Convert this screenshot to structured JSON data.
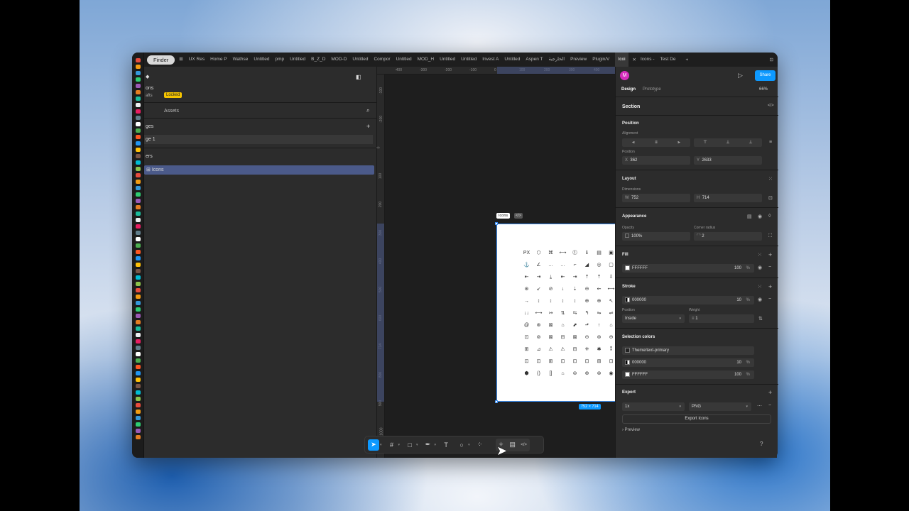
{
  "dock": {
    "app_label": "Finder"
  },
  "tabs": [
    "UX Res",
    "Home P",
    "Wathse",
    "Untitled",
    "pmp",
    "Untitled",
    "B_Z_D",
    "MOD-D",
    "Untitled",
    "Compor",
    "Untitled",
    "MOD_H",
    "Untitled",
    "Untitled",
    "Invest A",
    "Untitled",
    "Aspen T",
    "الخارجية",
    "Preview",
    "Plugin/V"
  ],
  "active_tab": "Icoi",
  "tabs_after": [
    "Icons -",
    "Test De"
  ],
  "left": {
    "file_name": "ons",
    "drafts_label": "afts",
    "locked_badge": "Locked",
    "assets_tab": "Assets",
    "pages_header": "ges",
    "page_item": "ge 1",
    "layers_header": "ers",
    "layer_item": "Icons"
  },
  "rulers": {
    "top": [
      "-400",
      "-300",
      "-200",
      "-100",
      "0",
      "100",
      "200",
      "300",
      "400",
      "500",
      "600",
      "752",
      "900",
      "100"
    ],
    "left": [
      "-100",
      "-200",
      "0",
      "100",
      "200",
      "300",
      "400",
      "500",
      "600",
      "714",
      "800",
      "900",
      "1000"
    ]
  },
  "frame": {
    "label": "Icons",
    "code_icon": "</>",
    "size_badge": "752 × 714"
  },
  "icons": [
    "PX",
    "⬡",
    "⌘",
    "⟷",
    "⓵",
    "ℹ",
    "▤",
    "▣",
    "⊞",
    "⊟",
    "⊡",
    "⊠",
    "⚓",
    "∠",
    "…",
    "…",
    "⌐",
    "◢",
    "◎",
    "▢",
    "⚱",
    "⎙",
    "▭",
    "⊟",
    "⇤",
    "⇥",
    "⤓",
    "⇤",
    "⇥",
    "⤒",
    "⤒",
    "⇩",
    "⇩",
    "◈",
    "⌖",
    "⊗",
    "⊛",
    "↙",
    "⊘",
    "↓",
    "⇣",
    "⊖",
    "⇜",
    "⟷",
    "⟷",
    "⟷",
    "⟷",
    "←",
    "→",
    "↕",
    "↕",
    "↕",
    "↕",
    "⊕",
    "⊕",
    "↖",
    "⊙",
    "↗",
    "↑",
    "↩",
    "↓↓",
    "⟷",
    "↣",
    "⇅",
    "⇆",
    "↰",
    "⇋",
    "⇌",
    "⇄",
    "⤴",
    "⇄",
    "⇉",
    "@",
    "⊛",
    "⊠",
    "⌂",
    "⬈",
    "⬏",
    "↑",
    "⌂",
    "⊗",
    "⌂",
    "⊲",
    "✦",
    "⊡",
    "⊚",
    "⊠",
    "⊟",
    "⊠",
    "⊝",
    "⊚",
    "⊖",
    "⊡",
    "⊙",
    "⊘",
    "⊗",
    "⊞",
    "⊿",
    "⚠",
    "⚠",
    "⊟",
    "⁜",
    "✱",
    "⁑",
    "◑",
    "B",
    "✕",
    "✧",
    "⊡",
    "⊡",
    "⊞",
    "⊡",
    "⊡",
    "⊡",
    "⊞",
    "⊡",
    "⊡",
    "🔒",
    "⊡",
    "⊞",
    "⬢",
    "()",
    "[]",
    "⌂",
    "⊜",
    "⊕",
    "⊛",
    "◉",
    "⊖",
    "⊘",
    "⊛",
    "⊕"
  ],
  "toolbar": {
    "tools": [
      "move",
      "frame",
      "rect",
      "pen",
      "text",
      "comment",
      "components",
      "ai",
      "dev",
      "code"
    ]
  },
  "right": {
    "avatar": "M",
    "share_button": "Share",
    "design_tab": "Design",
    "prototype_tab": "Prototype",
    "zoom": "66%",
    "section_title": "Section",
    "position_title": "Position",
    "alignment_label": "Alignment",
    "position_label": "Position",
    "x_label": "X",
    "x_value": "362",
    "y_label": "Y",
    "y_value": "2633",
    "layout_title": "Layout",
    "dimensions_label": "Dimensions",
    "w_label": "W",
    "w_value": "752",
    "h_label": "H",
    "h_value": "714",
    "appearance_title": "Appearance",
    "opacity_label": "Opacity",
    "opacity_value": "100%",
    "corner_label": "Corner radius",
    "corner_value": "2",
    "fill_title": "Fill",
    "fill_hex": "FFFFFF",
    "fill_opacity": "100",
    "stroke_title": "Stroke",
    "stroke_hex": "000000",
    "stroke_opacity": "10",
    "stroke_position_label": "Position",
    "stroke_position_value": "Inside",
    "weight_label": "Weight",
    "weight_value": "1",
    "selection_title": "Selection colors",
    "sel_color1": "Theme/text-primary",
    "sel_color2_hex": "000000",
    "sel_color2_opacity": "10",
    "sel_color3_hex": "FFFFFF",
    "sel_color3_opacity": "100",
    "export_title": "Export",
    "export_scale": "1x",
    "export_format": "PNG",
    "export_button": "Export Icons",
    "preview_label": "Preview",
    "percent": "%",
    "help": "?"
  },
  "colors": {
    "accent": "#0d99ff",
    "locked": "#f5c400",
    "avatar": "#d62dbb",
    "selection": "#3d8ef0"
  }
}
